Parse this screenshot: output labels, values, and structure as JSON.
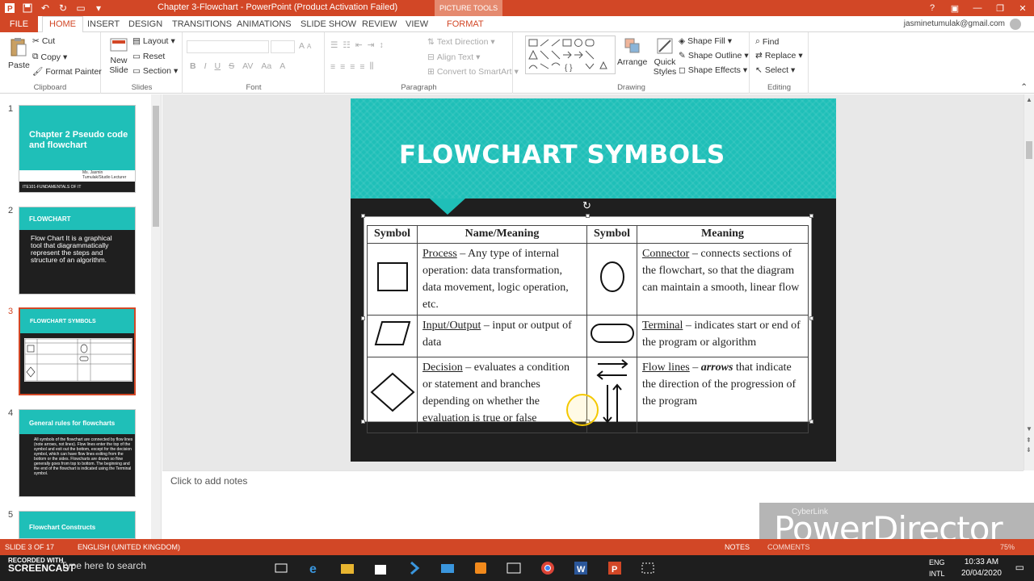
{
  "window": {
    "title": "Chapter 3-Flowchart -  PowerPoint (Product Activation Failed)",
    "picture_tools": "PICTURE TOOLS",
    "colors": {
      "accent": "#d24726",
      "teal": "#1fbfb8"
    }
  },
  "tabs": {
    "file": "FILE",
    "items": [
      "HOME",
      "INSERT",
      "DESIGN",
      "TRANSITIONS",
      "ANIMATIONS",
      "SLIDE SHOW",
      "REVIEW",
      "VIEW"
    ],
    "format": "FORMAT",
    "user": "jasminetumulak@gmail.com"
  },
  "ribbon": {
    "clipboard": {
      "paste": "Paste",
      "cut": "Cut",
      "copy": "Copy",
      "format_painter": "Format Painter",
      "label": "Clipboard"
    },
    "slides": {
      "new_slide": "New Slide",
      "layout": "Layout",
      "reset": "Reset",
      "section": "Section",
      "label": "Slides"
    },
    "font": {
      "label": "Font"
    },
    "paragraph": {
      "text_direction": "Text Direction",
      "align_text": "Align Text",
      "convert_smartart": "Convert to SmartArt",
      "label": "Paragraph"
    },
    "drawing": {
      "arrange": "Arrange",
      "quick_styles": "Quick Styles",
      "shape_fill": "Shape Fill",
      "shape_outline": "Shape Outline",
      "shape_effects": "Shape Effects",
      "label": "Drawing"
    },
    "editing": {
      "find": "Find",
      "replace": "Replace",
      "select": "Select",
      "label": "Editing"
    }
  },
  "thumbnails": [
    {
      "num": "1",
      "title": "Chapter 2 Pseudo code and flowchart",
      "sub": "Ms. Jasmin Tumulak/Studio Lecturer",
      "footer": "ITE101-FUNDAMENTALS OF IT"
    },
    {
      "num": "2",
      "title": "FLOWCHART",
      "body": "Flow Chart  It is a graphical tool that diagrammatically represent  the steps and structure of an algorithm."
    },
    {
      "num": "3",
      "title": "FLOWCHART SYMBOLS"
    },
    {
      "num": "4",
      "title": "General rules for flowcharts",
      "body": "All symbols of the flowchart are connected by flow lines (note arrows, not lines). Flow lines enter the top of the symbol and exit out the bottom, except for the decision symbol, which can have flow lines exiting from the bottom or the sides. Flowcharts are drawn so flow generally goes from top to bottom. The beginning and the end of the flowchart is indicated using the Terminal symbol."
    },
    {
      "num": "5",
      "title": "Flowchart Constructs"
    }
  ],
  "slide": {
    "title": "FLOWCHART SYMBOLS",
    "table": {
      "headers": [
        "Symbol",
        "Name/Meaning",
        "Symbol",
        "Meaning"
      ],
      "rows": [
        {
          "left_name": "Process",
          "left_text": " – Any type of internal operation: data transformation, data movement, logic operation, etc.",
          "right_name": "Connector",
          "right_text": " – connects sections of the flowchart, so that the diagram can maintain a smooth, linear flow"
        },
        {
          "left_name": "Input/Output",
          "left_text": " – input or output of data",
          "right_name": "Terminal",
          "right_text": " – indicates start or end of the program or algorithm"
        },
        {
          "left_name": "Decision",
          "left_text": " – evaluates a condition or statement and branches depending on whether the evaluation is true or false",
          "right_name": "Flow lines",
          "right_em": "arrows",
          "right_pre": " – ",
          "right_text": " that indicate the direction of the progression of the program"
        }
      ]
    }
  },
  "notes": {
    "placeholder": "Click to add notes"
  },
  "status": {
    "slide": "SLIDE 3 OF 17",
    "language": "ENGLISH (UNITED KINGDOM)",
    "notes": "NOTES",
    "comments": "COMMENTS",
    "zoom": "75%"
  },
  "taskbar": {
    "search": "Type here to search",
    "lang": "ENG",
    "lang2": "INTL",
    "time": "10:33 AM",
    "date": "20/04/2020"
  },
  "watermark": {
    "small": "CyberLink",
    "big": "PowerDirector",
    "rec": "RECORDED WITH",
    "brand": "SCREENCAST"
  }
}
